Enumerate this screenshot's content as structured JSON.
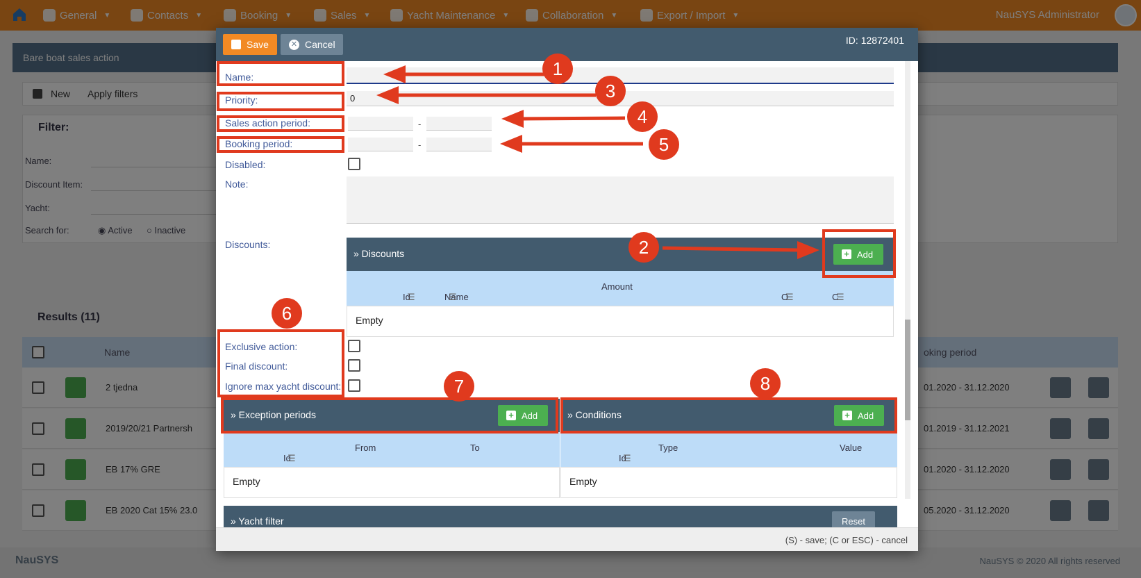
{
  "nav": {
    "items": [
      {
        "label": "General",
        "icon": "gear-icon"
      },
      {
        "label": "Contacts",
        "icon": "people-icon"
      },
      {
        "label": "Booking",
        "icon": "briefcase-icon"
      },
      {
        "label": "Sales",
        "icon": "dollar-icon"
      },
      {
        "label": "Yacht Maintenance",
        "icon": "wrench-icon"
      },
      {
        "label": "Collaboration",
        "icon": "chat-icon"
      },
      {
        "label": "Export / Import",
        "icon": "swap-icon"
      }
    ],
    "user": "NauSYS Administrator"
  },
  "background": {
    "page_title": "Bare boat sales action",
    "toolbar": {
      "new_label": "New",
      "apply_filters_label": "Apply filters"
    },
    "filter": {
      "title": "Filter:",
      "name_label": "Name:",
      "discount_item_label": "Discount Item:",
      "yacht_label": "Yacht:",
      "search_for_label": "Search for:",
      "radio_active": "Active",
      "radio_inactive": "Inactive"
    },
    "results": {
      "title": "Results (11)",
      "col_name": "Name",
      "col_booking_period": "oking period",
      "rows": [
        {
          "name": "2 tjedna",
          "period": "01.2020 - 31.12.2020"
        },
        {
          "name": "2019/20/21 Partnersh",
          "period": "01.2019 - 31.12.2021"
        },
        {
          "name": "EB 17% GRE",
          "period": "01.2020 - 31.12.2020"
        },
        {
          "name": "EB 2020 Cat 15% 23.0",
          "period": "05.2020 - 31.12.2020"
        }
      ]
    },
    "footer": {
      "logo": "NauSYS",
      "copyright": "NauSYS © 2020 All rights reserved"
    }
  },
  "dialog": {
    "save_label": "Save",
    "cancel_label": "Cancel",
    "id_text": "ID: 12872401",
    "fields": {
      "name_label": "Name:",
      "name_value": "",
      "priority_label": "Priority:",
      "priority_value": "0",
      "sales_period_label": "Sales action period:",
      "booking_period_label": "Booking period:",
      "period_separator": "-",
      "disabled_label": "Disabled:",
      "note_label": "Note:",
      "discounts_label": "Discounts:",
      "exclusive_label": "Exclusive action:",
      "final_label": "Final discount:",
      "ignore_label": "Ignore max yacht discount:"
    },
    "discounts_panel": {
      "title": "» Discounts",
      "add_label": "Add",
      "columns": [
        "Id",
        "Name",
        "Amount",
        "O",
        "C"
      ],
      "empty": "Empty"
    },
    "exceptions_panel": {
      "title": "» Exception periods",
      "add_label": "Add",
      "columns": [
        "Id",
        "From",
        "To"
      ],
      "empty": "Empty"
    },
    "conditions_panel": {
      "title": "» Conditions",
      "add_label": "Add",
      "columns": [
        "Id",
        "Type",
        "Value"
      ],
      "empty": "Empty"
    },
    "yacht_filter_panel": {
      "title": "» Yacht filter",
      "reset_label": "Reset"
    },
    "footer_hint": "(S) - save; (C or ESC) - cancel"
  },
  "annotations": [
    "1",
    "2",
    "3",
    "4",
    "5",
    "6",
    "7",
    "8"
  ],
  "colors": {
    "annotation": "#e03a1e",
    "nav": "#f28a24",
    "panel": "#425b6e",
    "add": "#4caf50"
  }
}
